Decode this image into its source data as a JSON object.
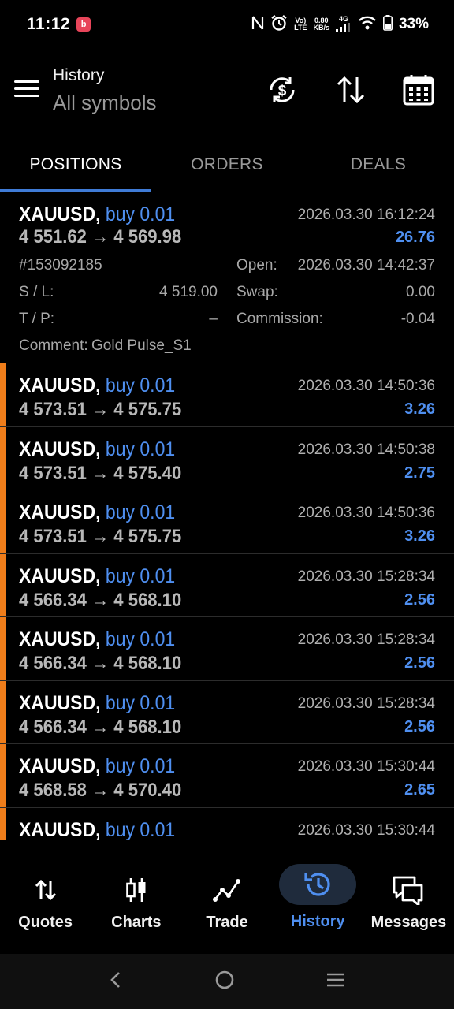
{
  "status_bar": {
    "time": "11:12",
    "notification_icon": "b",
    "network": "0.80\nKB/s",
    "signal": "4G",
    "battery": "33%"
  },
  "header": {
    "title": "History",
    "subtitle": "All symbols"
  },
  "tabs": [
    {
      "label": "POSITIONS",
      "active": true
    },
    {
      "label": "ORDERS",
      "active": false
    },
    {
      "label": "DEALS",
      "active": false
    }
  ],
  "expanded_position": {
    "symbol": "XAUUSD,",
    "side": "buy 0.01",
    "prices": "4 551.62 → 4 569.98",
    "time": "2026.03.30 16:12:24",
    "profit": "26.76",
    "ticket": "#153092185",
    "sl_label": "S / L:",
    "sl_value": "4 519.00",
    "tp_label": "T / P:",
    "tp_value": "–",
    "open_label": "Open:",
    "open_value": "2026.03.30 14:42:37",
    "swap_label": "Swap:",
    "swap_value": "0.00",
    "commission_label": "Commission:",
    "commission_value": "-0.04",
    "comment_label": "Comment:",
    "comment_value": "Gold Pulse_S1"
  },
  "positions": [
    {
      "symbol": "XAUUSD,",
      "side": "buy 0.01",
      "prices": "4 573.51 → 4 575.75",
      "time": "2026.03.30 14:50:36",
      "profit": "3.26"
    },
    {
      "symbol": "XAUUSD,",
      "side": "buy 0.01",
      "prices": "4 573.51 → 4 575.40",
      "time": "2026.03.30 14:50:38",
      "profit": "2.75"
    },
    {
      "symbol": "XAUUSD,",
      "side": "buy 0.01",
      "prices": "4 573.51 → 4 575.75",
      "time": "2026.03.30 14:50:36",
      "profit": "3.26"
    },
    {
      "symbol": "XAUUSD,",
      "side": "buy 0.01",
      "prices": "4 566.34 → 4 568.10",
      "time": "2026.03.30 15:28:34",
      "profit": "2.56"
    },
    {
      "symbol": "XAUUSD,",
      "side": "buy 0.01",
      "prices": "4 566.34 → 4 568.10",
      "time": "2026.03.30 15:28:34",
      "profit": "2.56"
    },
    {
      "symbol": "XAUUSD,",
      "side": "buy 0.01",
      "prices": "4 566.34 → 4 568.10",
      "time": "2026.03.30 15:28:34",
      "profit": "2.56"
    },
    {
      "symbol": "XAUUSD,",
      "side": "buy 0.01",
      "prices": "4 568.58 → 4 570.40",
      "time": "2026.03.30 15:30:44",
      "profit": "2.65"
    },
    {
      "symbol": "XAUUSD,",
      "side": "buy 0.01",
      "prices": "",
      "time": "2026.03.30 15:30:44",
      "profit": ""
    }
  ],
  "bottom_nav": [
    {
      "label": "Quotes",
      "icon": "arrows-updown-icon",
      "active": false
    },
    {
      "label": "Charts",
      "icon": "candlestick-icon",
      "active": false
    },
    {
      "label": "Trade",
      "icon": "trend-line-icon",
      "active": false
    },
    {
      "label": "History",
      "icon": "history-clock-icon",
      "active": true
    },
    {
      "label": "Messages",
      "icon": "chat-bubbles-icon",
      "active": false
    }
  ],
  "colors": {
    "accent_blue": "#4f8ff0",
    "buy_bar_orange": "#ef7d1a",
    "tab_indicator": "#3f7bd6",
    "background": "#000000"
  }
}
